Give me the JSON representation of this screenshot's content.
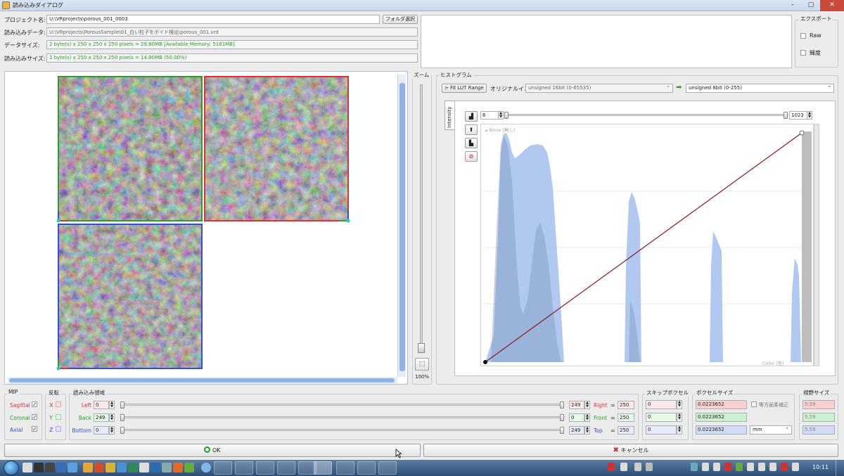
{
  "window": {
    "title": "読み込みダイアログ",
    "controls": {
      "minimize": "–",
      "maximize": "▢",
      "close": "✕"
    }
  },
  "project": {
    "label": "プロジェクト名:",
    "value": "U:\\VRprojects\\porous_001_0003",
    "folder_button": "フォルダ選択"
  },
  "read_data": {
    "label": "読み込みデータ:",
    "value": "U:\\VRprojects\\PorousSample\\01_白い粒子をボイド検出\\porous_001.vrd"
  },
  "data_size": {
    "label": "データサイズ:",
    "value": "2 byte(s) x 250 x 250 x 250 pixels = 29.80MB  [Available Memory: 5181MB]"
  },
  "load_size": {
    "label": "読み込みサイズ:",
    "value": "1 byte(s) x 250 x 250 x 250 pixels = 14.90MB (50.00%)"
  },
  "export": {
    "title": "エクスポート",
    "raw": "Raw",
    "luminance": "輝度"
  },
  "zoom": {
    "title": "ズーム",
    "value": "100%"
  },
  "histogram": {
    "title": "ヒストグラム",
    "fit_button": "Fit LUT Range",
    "original_label": "オリジナルイン",
    "original_select": "unsigned 16bit (0-65535)",
    "target_select": "unsigned 8bit (0-255)",
    "tab": "Intensity",
    "min_value": "6",
    "max_value": "1023",
    "none_label": "None (無し)",
    "color_label": "Color (色)"
  },
  "mip": {
    "title": "MIP",
    "sagittal": "Sagittal",
    "coronal": "Coronal",
    "axial": "Axial"
  },
  "flip": {
    "title": "反転",
    "x": "X",
    "y": "Y",
    "z": "Z"
  },
  "region": {
    "title": "読み込み領域",
    "rows": [
      {
        "left_label": "Left",
        "left_value": "0",
        "right_value": "249",
        "right_label": "Right",
        "eq": "=",
        "size": "250"
      },
      {
        "left_label": "Back",
        "left_value": "249",
        "right_value": "0",
        "right_label": "Front",
        "eq": "=",
        "size": "250"
      },
      {
        "left_label": "Bottom",
        "left_value": "0",
        "right_value": "249",
        "right_label": "Top",
        "eq": "=",
        "size": "250"
      }
    ]
  },
  "skip": {
    "title": "スキップボクセル",
    "values": [
      "0",
      "0",
      "0"
    ]
  },
  "voxel": {
    "title": "ボクセルサイズ",
    "values": [
      "0.0223652",
      "0.0223652",
      "0.0223652"
    ],
    "isotropic_label": "等方画素補正",
    "unit": "mm"
  },
  "fov": {
    "title": "視野サイズ",
    "values": [
      "5.59",
      "5.59",
      "5.59"
    ]
  },
  "buttons": {
    "ok": "OK",
    "cancel": "キャンセル"
  },
  "taskbar": {
    "clock": "10:11"
  },
  "colors": {
    "sagittal": "#e03030",
    "coronal": "#2aa02a",
    "axial": "#3050d0",
    "hist_fill": "#a9c3ef",
    "lut_line": "#8b1a1a"
  },
  "chart_data": {
    "type": "area",
    "x_range": [
      6,
      1023
    ],
    "lut_line": {
      "from": [
        6,
        0
      ],
      "to": [
        1023,
        255
      ]
    }
  }
}
